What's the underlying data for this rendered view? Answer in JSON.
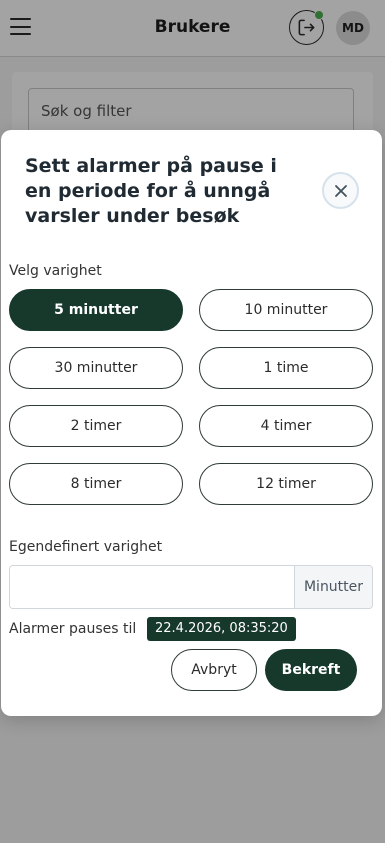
{
  "header": {
    "title": "Brukere",
    "menu_icon": "hamburger-menu-icon",
    "logout_icon": "logout-icon",
    "avatar_initials": "MD",
    "online_status_color": "#4caf50"
  },
  "search": {
    "placeholder": "Søk og filter"
  },
  "dialog": {
    "title": "Sett alarmer på pause i en periode for å unngå varsler under besøk",
    "close_icon": "close-icon",
    "duration_label": "Velg varighet",
    "durations": [
      {
        "label": "5 minutter",
        "selected": true
      },
      {
        "label": "10 minutter",
        "selected": false
      },
      {
        "label": "30 minutter",
        "selected": false
      },
      {
        "label": "1 time",
        "selected": false
      },
      {
        "label": "2 timer",
        "selected": false
      },
      {
        "label": "4 timer",
        "selected": false
      },
      {
        "label": "8 timer",
        "selected": false
      },
      {
        "label": "12 timer",
        "selected": false
      }
    ],
    "custom_label": "Egendefinert varighet",
    "custom_value": "",
    "custom_unit": "Minutter",
    "paused_until_label": "Alarmer pauses til",
    "paused_until_value": "22.4.2026, 08:35:20",
    "cancel_label": "Avbryt",
    "confirm_label": "Bekreft"
  },
  "colors": {
    "accent": "#17392c",
    "backdrop": "rgba(0,0,0,0.36)"
  }
}
